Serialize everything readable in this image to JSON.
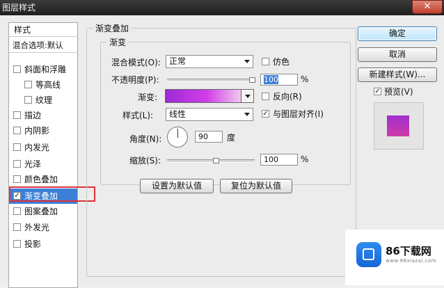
{
  "window": {
    "title": "图层样式",
    "close": "✕"
  },
  "sidebar": {
    "header": "样式",
    "blend_options": "混合选项:默认",
    "items": [
      {
        "label": "斜面和浮雕",
        "checked": false
      },
      {
        "label": "等高线",
        "checked": false
      },
      {
        "label": "纹理",
        "checked": false
      },
      {
        "label": "描边",
        "checked": false
      },
      {
        "label": "内阴影",
        "checked": false
      },
      {
        "label": "内发光",
        "checked": false
      },
      {
        "label": "光泽",
        "checked": false
      },
      {
        "label": "颜色叠加",
        "checked": false
      },
      {
        "label": "渐变叠加",
        "checked": true,
        "selected": true
      },
      {
        "label": "图案叠加",
        "checked": false
      },
      {
        "label": "外发光",
        "checked": false
      },
      {
        "label": "投影",
        "checked": false
      }
    ]
  },
  "panel": {
    "title": "渐变叠加",
    "group_title": "渐变",
    "blend_mode_label": "混合模式(O):",
    "blend_mode_value": "正常",
    "dither_label": "仿色",
    "opacity_label": "不透明度(P):",
    "opacity_value": "100",
    "percent": "%",
    "gradient_label": "渐变:",
    "reverse_label": "反向(R)",
    "style_label": "样式(L):",
    "style_value": "线性",
    "align_label": "与图层对齐(I)",
    "angle_label": "角度(N):",
    "angle_value": "90",
    "degree": "度",
    "scale_label": "缩放(S):",
    "scale_value": "100",
    "make_default": "设置为默认值",
    "reset_default": "复位为默认值"
  },
  "buttons": {
    "ok": "确定",
    "cancel": "取消",
    "new_style": "新建样式(W)...",
    "preview": "预览(V)"
  },
  "watermark": {
    "brand": "86下载网",
    "url": "www.86xiazai.com"
  },
  "colors": {
    "selection": "#3d7fd6",
    "gradient_start": "#9b2bd6",
    "gradient_end": "#f0c9ef",
    "highlight_box": "#e0313b"
  }
}
